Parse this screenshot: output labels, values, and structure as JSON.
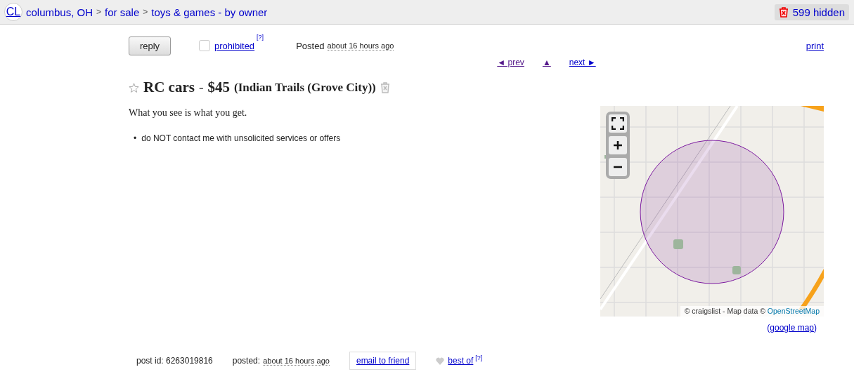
{
  "header": {
    "logo": "CL",
    "breadcrumbs": [
      {
        "label": "columbus, OH"
      },
      {
        "label": "for sale"
      },
      {
        "label": "toys & games - by owner"
      }
    ],
    "separator": ">",
    "hidden": "599 hidden"
  },
  "actions": {
    "reply": "reply",
    "prohibited": {
      "label": "prohibited",
      "checked": false,
      "help": "[?]"
    },
    "posted_label": "Posted",
    "posted_time": "about 16 hours ago",
    "print": "print"
  },
  "nav": {
    "prev": "◄ prev",
    "up": "▲",
    "next": "next ►"
  },
  "post": {
    "starred": false,
    "title": "RC cars",
    "separator": "-",
    "price": "$45",
    "location": "(Indian Trails (Grove City))",
    "body": "What you see is what you get.",
    "notices": [
      {
        "bullet": "•",
        "text": "do NOT contact me with unsolicited services or offers"
      }
    ]
  },
  "map": {
    "controls": [
      {
        "kind": "fullscreen"
      },
      {
        "kind": "zoom-in"
      },
      {
        "kind": "zoom-out"
      }
    ],
    "attribution": "© craigslist - Map data ©",
    "attribution_link": "OpenStreetMap",
    "google_map": "google map",
    "open_paren": "(",
    "close_paren": ")"
  },
  "footer": {
    "post_id": "post id: 6263019816",
    "posted_label": "posted:",
    "posted_time": "about 16 hours ago",
    "email": "email to friend",
    "best_of": "best of",
    "help": "[?]"
  }
}
